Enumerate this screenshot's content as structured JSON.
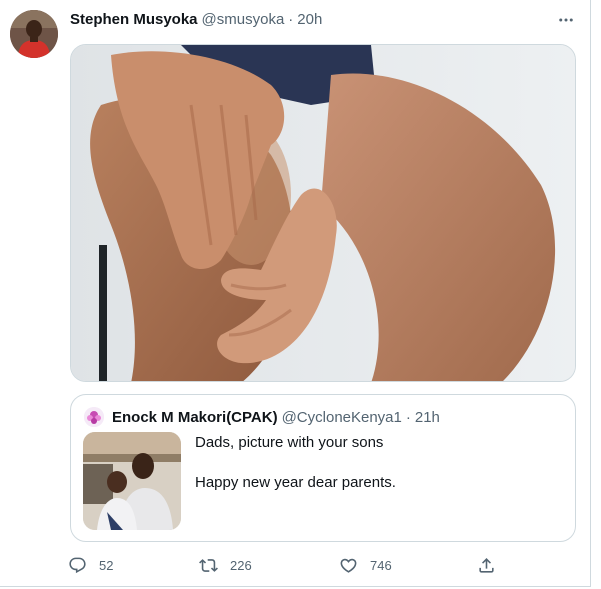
{
  "tweet": {
    "author_name": "Stephen Musyoka",
    "author_handle": "@smusyoka",
    "separator": "·",
    "time": "20h"
  },
  "quoted": {
    "author_name": "Enock M Makori(CPAK)",
    "author_handle": "@CycloneKenya1",
    "separator": "·",
    "time": "21h",
    "line1": "Dads,  picture with your sons",
    "line2": "Happy new year dear parents."
  },
  "actions": {
    "reply_count": "52",
    "retweet_count": "226",
    "like_count": "746"
  },
  "icons": {
    "more": "more-dots-icon",
    "reply": "reply-icon",
    "retweet": "retweet-icon",
    "like": "heart-icon",
    "share": "share-icon"
  },
  "colors": {
    "text": "#0f1419",
    "muted": "#536471",
    "border": "#cfd9de"
  }
}
